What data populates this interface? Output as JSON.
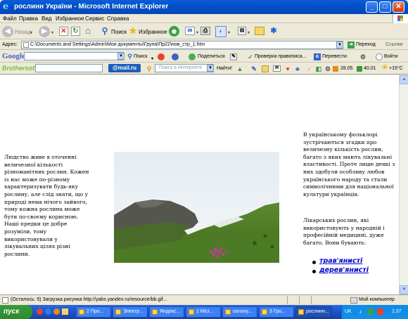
{
  "window": {
    "title": "рослинн України - Microsoft Internet Explorer",
    "min_label": "_",
    "max_label": "□",
    "close_label": "✕"
  },
  "menu": [
    "Файл",
    "Правка",
    "Вид",
    "Избранное",
    "Сервис",
    "Справка"
  ],
  "nav": {
    "back_label": "Назад",
    "search_label": "Поиск",
    "favorites_label": "Избранное"
  },
  "address": {
    "label": "Адрес:",
    "value": "C:\\Documents and Settings\\Admin\\Мои документы\\Група\\Пр22\\нов_стр_1.htm",
    "go_label": "Переход",
    "links_label": "Ссылки"
  },
  "google": {
    "logo": "Google",
    "search_label": "Поиск",
    "share_label": "Поделиться",
    "spellcheck_label": "Проверка правописа...",
    "translate_label": "Перевести",
    "signin_label": "Войти"
  },
  "brothersoft": {
    "logo": "Brothersoft",
    "mail_logo": "@mail.ru",
    "search_placeholder": "Поиск в Интернете",
    "find_label": "Найти!",
    "rate1": "28.05",
    "rate2": "40.01",
    "temp": "+15°C"
  },
  "content": {
    "left_text": "Людство живе в оточенні величезної кількості різноманітних рослин. Кожен із нас може по-різному характеризувати будь-яку рослину, але слід знати, що у природі нема нічого зайвого, тому кожна рослина може бути по-своєму корисною. Наші предки це добре розуміли, тому використовували у лікувальних цілях різні рослини.",
    "right_text_1": "В українському фольклорі зустрічаються згадки про величезну кількість рослин, багато з яких мають лікувальні властивості. Проте лише деякі з них здобули особливу любов українського народу та стали символічними для національної культури українців.",
    "right_text_2": "Лікарських рослин, які використовують у народній і професійній медицині, дуже багато. Вони бувають:",
    "list": [
      "трав'янисті",
      "дерев'янисті"
    ]
  },
  "status": {
    "text": "(Осталось: 5) Загрузка рисунка http://yabs.yandex.ru/resource/bb.gif...",
    "zone": "Мой компьютер"
  },
  "taskbar": {
    "start_label": "пуск",
    "tasks": [
      "2 Про...",
      "Электр...",
      "Яндекс...",
      "2 Micr...",
      "osnovy...",
      "3 Гро...",
      "рослинн..."
    ],
    "lang": "UK",
    "clock": "1:37"
  },
  "colors": {
    "titlebar": "#0050c8",
    "link": "#0000cc",
    "taskbar": "#245edb",
    "start": "#2b8a2b"
  }
}
